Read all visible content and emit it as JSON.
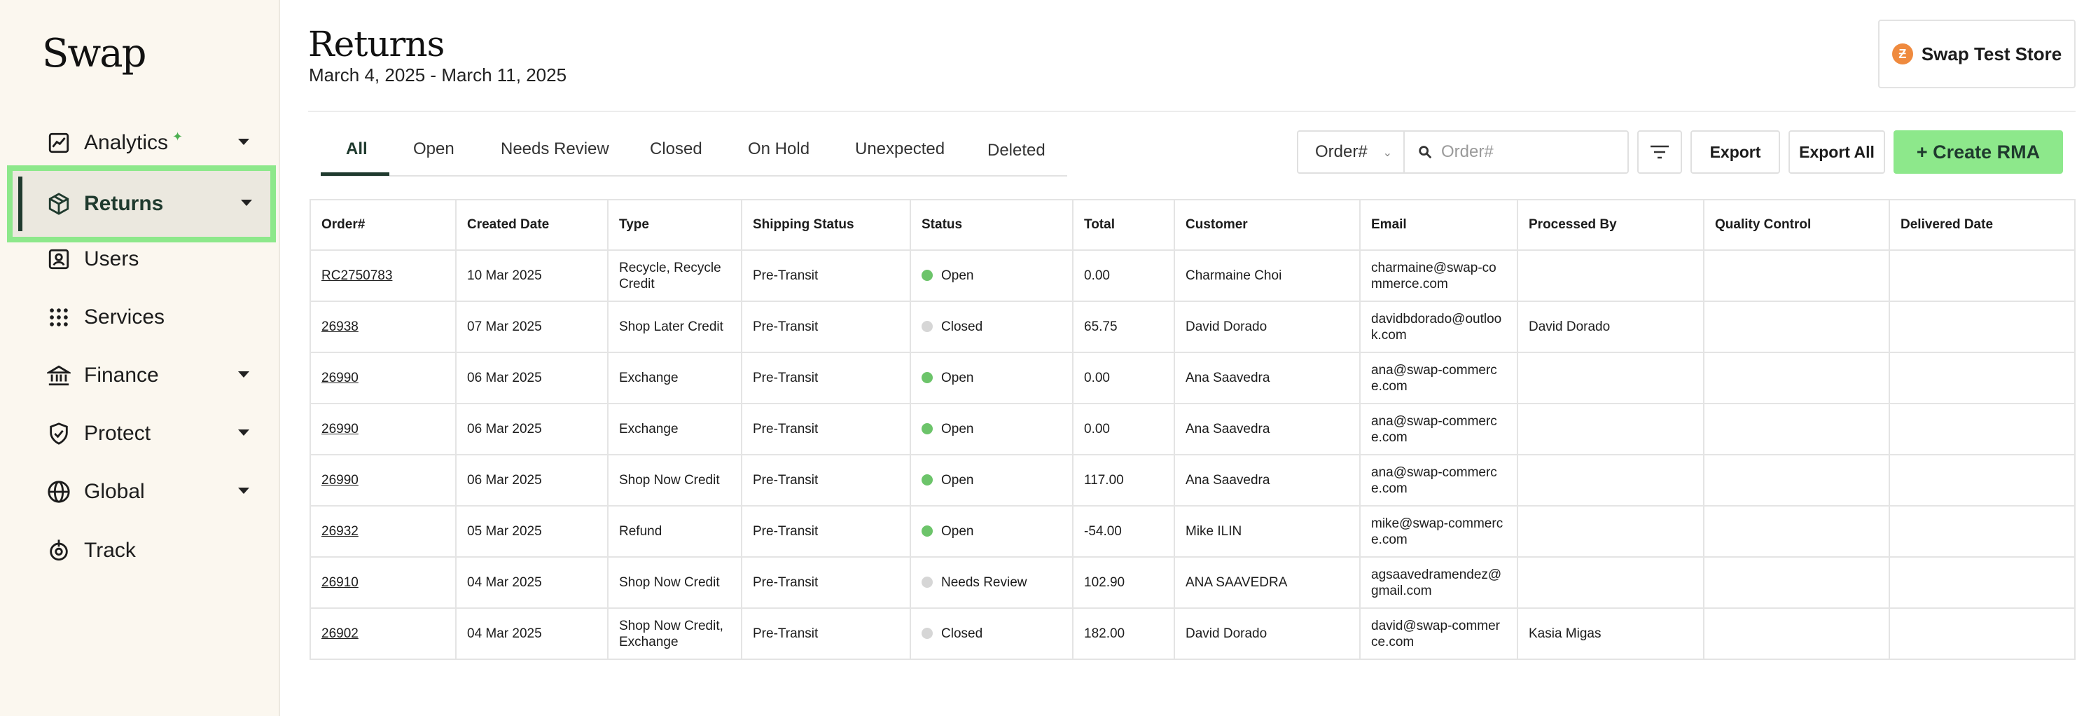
{
  "brand": {
    "logo_text": "Swap"
  },
  "sidebar": {
    "items": [
      {
        "label": "Analytics",
        "icon": "chart-line-icon",
        "has_caret": true
      },
      {
        "label": "Returns",
        "icon": "box-icon",
        "has_caret": true,
        "active": true
      },
      {
        "label": "Users",
        "icon": "user-card-icon",
        "has_caret": false
      },
      {
        "label": "Services",
        "icon": "grid-dots-icon",
        "has_caret": false
      },
      {
        "label": "Finance",
        "icon": "bank-icon",
        "has_caret": true
      },
      {
        "label": "Protect",
        "icon": "shield-check-icon",
        "has_caret": true
      },
      {
        "label": "Global",
        "icon": "globe-icon",
        "has_caret": true
      },
      {
        "label": "Track",
        "icon": "location-target-icon",
        "has_caret": false
      }
    ]
  },
  "header": {
    "title": "Returns",
    "date_range": "March 4, 2025 - March 11, 2025",
    "store": {
      "logo_letter": "Ƶ",
      "name": "Swap Test Store"
    }
  },
  "tabs": [
    {
      "label": "All",
      "active": true
    },
    {
      "label": "Open"
    },
    {
      "label": "Needs Review"
    },
    {
      "label": "Closed"
    },
    {
      "label": "On Hold"
    },
    {
      "label": "Unexpected"
    },
    {
      "label": "Deleted"
    }
  ],
  "toolbar": {
    "search_field_select": "Order#",
    "search_placeholder": "Order#",
    "export_label": "Export",
    "export_all_label": "Export All",
    "create_label": "+ Create RMA"
  },
  "table": {
    "columns": [
      "Order#",
      "Created Date",
      "Type",
      "Shipping Status",
      "Status",
      "Total",
      "Customer",
      "Email",
      "Processed By",
      "Quality Control",
      "Delivered Date"
    ],
    "rows": [
      {
        "order": "RC2750783",
        "created": "10 Mar 2025",
        "type": "Recycle, Recycle Credit",
        "shipping": "Pre-Transit",
        "status": "Open",
        "total": "0.00",
        "customer": "Charmaine Choi",
        "email": "charmaine@swap-commerce.com",
        "processed_by": "",
        "quality_control": "",
        "delivered": ""
      },
      {
        "order": "26938",
        "created": "07 Mar 2025",
        "type": "Shop Later Credit",
        "shipping": "Pre-Transit",
        "status": "Closed",
        "total": "65.75",
        "customer": "David Dorado",
        "email": "davidbdorado@outlook.com",
        "processed_by": "David Dorado",
        "quality_control": "",
        "delivered": ""
      },
      {
        "order": "26990",
        "created": "06 Mar 2025",
        "type": "Exchange",
        "shipping": "Pre-Transit",
        "status": "Open",
        "total": "0.00",
        "customer": "Ana Saavedra",
        "email": "ana@swap-commerce.com",
        "processed_by": "",
        "quality_control": "",
        "delivered": ""
      },
      {
        "order": "26990",
        "created": "06 Mar 2025",
        "type": "Exchange",
        "shipping": "Pre-Transit",
        "status": "Open",
        "total": "0.00",
        "customer": "Ana Saavedra",
        "email": "ana@swap-commerce.com",
        "processed_by": "",
        "quality_control": "",
        "delivered": ""
      },
      {
        "order": "26990",
        "created": "06 Mar 2025",
        "type": "Shop Now Credit",
        "shipping": "Pre-Transit",
        "status": "Open",
        "total": "117.00",
        "customer": "Ana Saavedra",
        "email": "ana@swap-commerce.com",
        "processed_by": "",
        "quality_control": "",
        "delivered": ""
      },
      {
        "order": "26932",
        "created": "05 Mar 2025",
        "type": "Refund",
        "shipping": "Pre-Transit",
        "status": "Open",
        "total": "-54.00",
        "customer": "Mike ILIN",
        "email": "mike@swap-commerce.com",
        "processed_by": "",
        "quality_control": "",
        "delivered": ""
      },
      {
        "order": "26910",
        "created": "04 Mar 2025",
        "type": "Shop Now Credit",
        "shipping": "Pre-Transit",
        "status": "Needs Review",
        "total": "102.90",
        "customer": "ANA SAAVEDRA",
        "email": "agsaavedramendez@gmail.com",
        "processed_by": "",
        "quality_control": "",
        "delivered": ""
      },
      {
        "order": "26902",
        "created": "04 Mar 2025",
        "type": "Shop Now Credit, Exchange",
        "shipping": "Pre-Transit",
        "status": "Closed",
        "total": "182.00",
        "customer": "David Dorado",
        "email": "david@swap-commerce.com",
        "processed_by": "Kasia Migas",
        "quality_control": "",
        "delivered": ""
      }
    ]
  },
  "colors": {
    "accent_green": "#8de88b",
    "dark_green": "#1f3a2e",
    "status_open": "#6cc46a",
    "status_neutral": "#d6d6d6",
    "sidebar_bg": "#fbf7ef"
  }
}
